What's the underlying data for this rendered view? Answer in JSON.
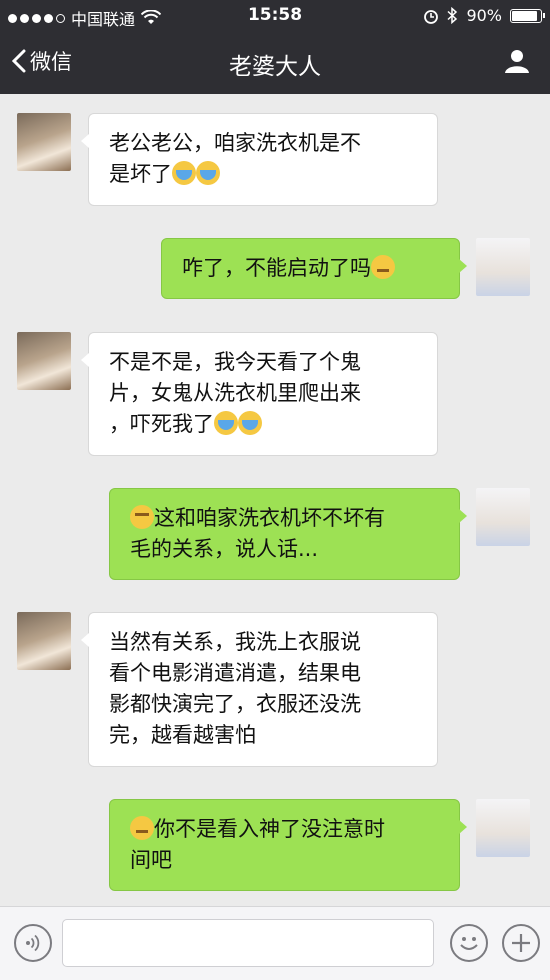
{
  "status_bar": {
    "carrier": "中国联通",
    "time": "15:58",
    "battery": "90%",
    "battery_level": 0.9,
    "icons": [
      "signal-dots",
      "wifi-icon",
      "alarm-icon",
      "bluetooth-icon",
      "battery-icon"
    ]
  },
  "nav": {
    "back_label": "微信",
    "title": "老婆大人",
    "profile_icon": "person-icon"
  },
  "messages": [
    {
      "side": "left",
      "lines": [
        "老公老公，咱家洗衣机是不",
        "是坏了"
      ],
      "trailing_emojis": [
        "cry",
        "cry"
      ]
    },
    {
      "side": "right",
      "lines": [
        "咋了，不能启动了吗"
      ],
      "trailing_emojis": [
        "think"
      ]
    },
    {
      "side": "left",
      "lines": [
        "不是不是，我今天看了个鬼",
        "片，女鬼从洗衣机里爬出来",
        "，吓死我了"
      ],
      "trailing_emojis": [
        "cry",
        "cry"
      ]
    },
    {
      "side": "right",
      "lines": [
        "这和咱家洗衣机坏不坏有",
        "毛的关系，说人话..."
      ],
      "leading_emoji": "sweat"
    },
    {
      "side": "left",
      "lines": [
        "当然有关系，我洗上衣服说",
        "看个电影消遣消遣，结果电",
        "影都快演完了，衣服还没洗",
        "完，越看越害怕"
      ]
    },
    {
      "side": "right",
      "lines": [
        "你不是看入神了没注意时",
        "间吧"
      ],
      "leading_emoji": "think"
    }
  ],
  "input_bar": {
    "voice_icon": "voice-icon",
    "text_value": "",
    "emoji_icon": "emoji-icon",
    "add_icon": "plus-icon"
  },
  "colors": {
    "bar_bg": "#2e2e33",
    "chat_bg": "#ebebeb",
    "sent_bubble": "#9de154",
    "received_bubble": "#ffffff"
  }
}
